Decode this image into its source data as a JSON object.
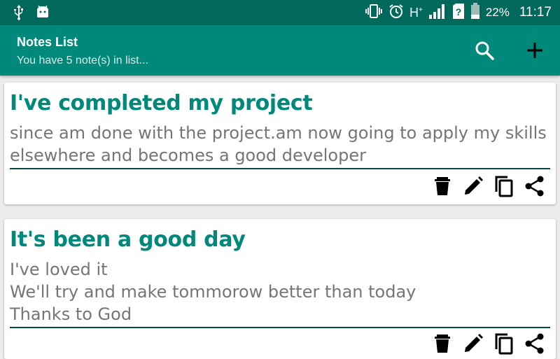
{
  "status_bar": {
    "left_icons": [
      "usb-icon",
      "android-debug-icon"
    ],
    "right_icons": [
      "vibrate-icon",
      "alarm-icon",
      "network-type-icon",
      "signal-icon",
      "sim-unknown-icon",
      "battery-icon"
    ],
    "network_type": "H",
    "network_type_sup": "+",
    "battery_percent": "22%",
    "time": "11:17"
  },
  "app_bar": {
    "title": "Notes List",
    "subtitle": "You have 5 note(s) in list...",
    "actions": [
      "search-icon",
      "add-icon"
    ]
  },
  "notes": [
    {
      "title": "I've completed my project",
      "body": "since am done with the project.am now going to apply my skills\nelsewhere and becomes a good developer"
    },
    {
      "title": "It's been a good day",
      "body": "I've loved it\nWe'll try and make tommorow better than today\nThanks to God"
    }
  ],
  "note_actions": [
    "delete-icon",
    "edit-icon",
    "copy-icon",
    "share-icon"
  ],
  "colors": {
    "status_bar": "#00695c",
    "app_bar": "#00897b",
    "title_text": "#00897b",
    "body_text": "#757575",
    "divider": "#004d40",
    "background": "#ececec"
  }
}
